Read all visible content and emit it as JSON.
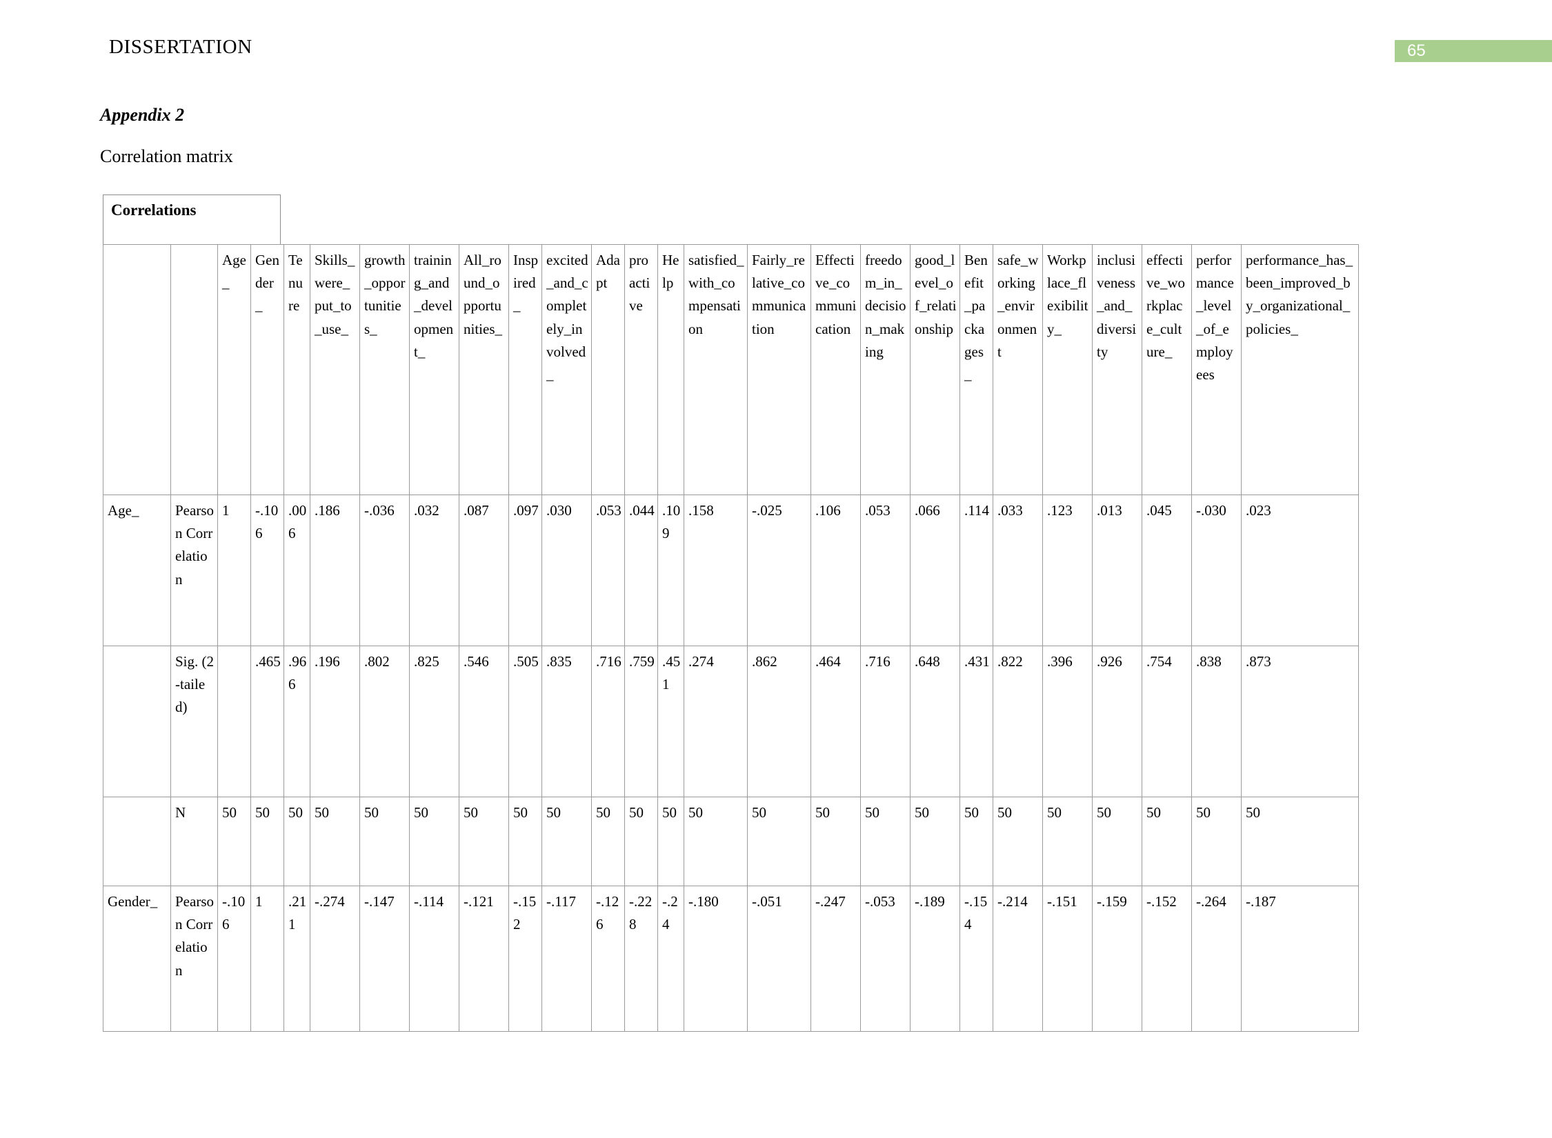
{
  "header": {
    "running_head": "DISSERTATION",
    "page_number": "65",
    "badge_color": "#a9cf8e"
  },
  "headings": {
    "appendix": "Appendix 2",
    "section": "Correlation matrix"
  },
  "table": {
    "caption": "Correlations",
    "stub_label": "",
    "stat_label": "",
    "columns": [
      "Age_",
      "Gender_",
      "Tenure",
      "Skills_were_put_to_use_",
      "growth_opportunities_",
      "training_and_development_",
      "All_round_opportunities_",
      "Inspired_",
      "excited_and_completely_involved_",
      "Adapt",
      "proactive",
      "Help",
      "satisfied_with_compensation",
      "Fairly_relative_communication",
      "Effective_communication",
      "freedom_in_decision_making",
      "good_level_of_relationship",
      "Benefit_packages_",
      "safe_working_environment",
      "Workplace_flexibility_",
      "inclusiveness_and_diversity",
      "effective_workplace_culture_",
      "performance_level_of_employees",
      "performance_has_been_improved_by_organizational_policies_"
    ],
    "rows": [
      {
        "variable": "Age_",
        "statistic": "Pearson Correlation",
        "values": [
          "1",
          "-.106",
          ".006",
          ".186",
          "-.036",
          ".032",
          ".087",
          ".097",
          ".030",
          ".053",
          ".044",
          ".109",
          ".158",
          "-.025",
          ".106",
          ".053",
          ".066",
          ".114",
          ".033",
          ".123",
          ".013",
          ".045",
          "-.030",
          ".023"
        ]
      },
      {
        "variable": "",
        "statistic": "Sig. (2-tailed)",
        "values": [
          "",
          ".465",
          ".966",
          ".196",
          ".802",
          ".825",
          ".546",
          ".505",
          ".835",
          ".716",
          ".759",
          ".451",
          ".274",
          ".862",
          ".464",
          ".716",
          ".648",
          ".431",
          ".822",
          ".396",
          ".926",
          ".754",
          ".838",
          ".873"
        ]
      },
      {
        "variable": "",
        "statistic": "N",
        "values": [
          "50",
          "50",
          "50",
          "50",
          "50",
          "50",
          "50",
          "50",
          "50",
          "50",
          "50",
          "50",
          "50",
          "50",
          "50",
          "50",
          "50",
          "50",
          "50",
          "50",
          "50",
          "50",
          "50",
          "50"
        ]
      },
      {
        "variable": "Gender_",
        "statistic": "Pearson Correlation",
        "values": [
          "-.106",
          "1",
          ".211",
          "-.274",
          "-.147",
          "-.114",
          "-.121",
          "-.152",
          "-.117",
          "-.126",
          "-.228",
          "-.24",
          "-.180",
          "-.051",
          "-.247",
          "-.053",
          "-.189",
          "-.154",
          "-.214",
          "-.151",
          "-.159",
          "-.152",
          "-.264",
          "-.187"
        ]
      }
    ]
  }
}
